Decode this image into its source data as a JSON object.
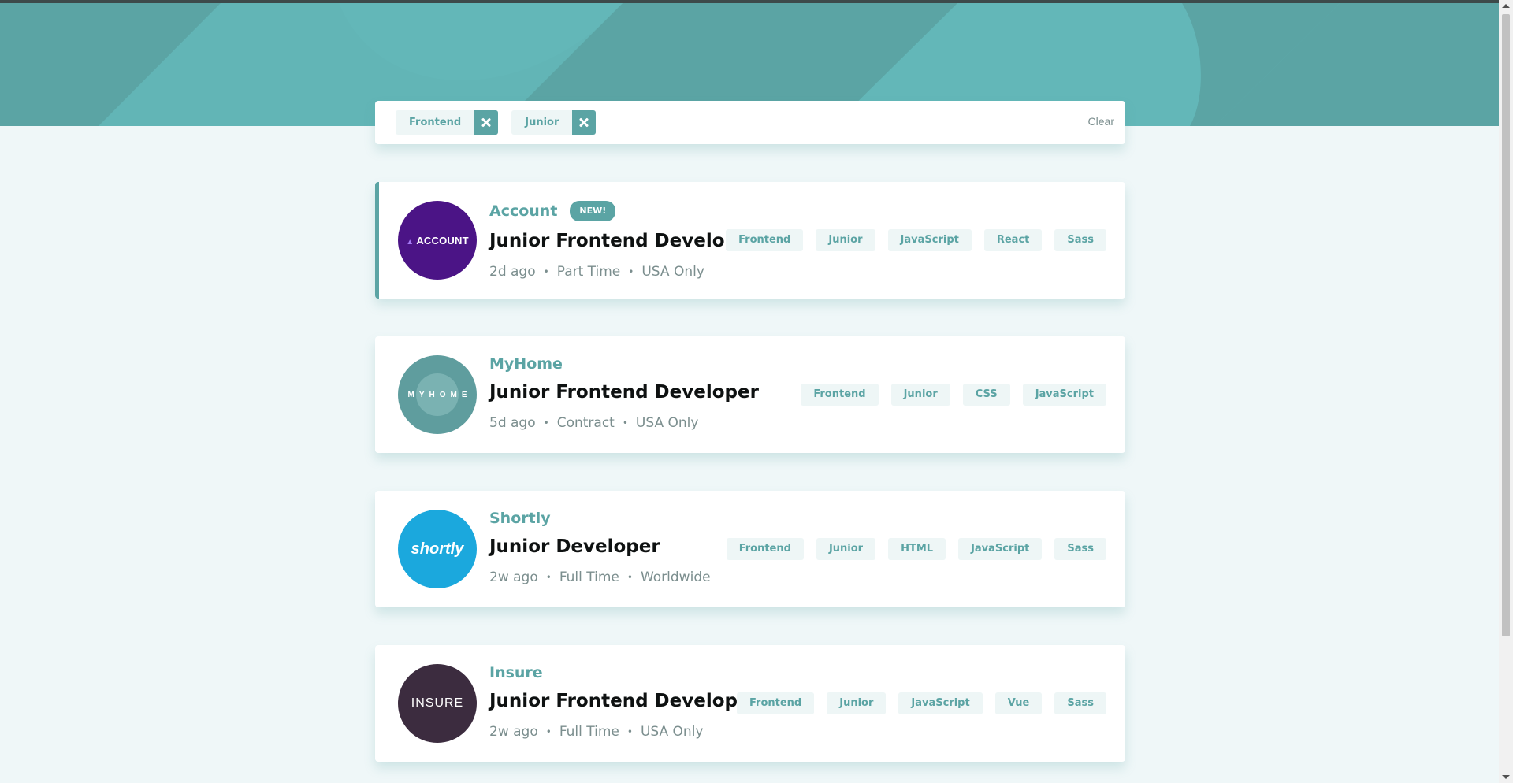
{
  "filters": {
    "active": [
      {
        "label": "Frontend"
      },
      {
        "label": "Junior"
      }
    ],
    "clear_label": "Clear"
  },
  "jobs": [
    {
      "company": "Account",
      "logo_text": "ACCOUNT",
      "logo_color": "#4b1486",
      "badge": "NEW!",
      "position": "Junior Frontend Developer",
      "posted": "2d ago",
      "contract": "Part Time",
      "location": "USA Only",
      "tags": [
        "Frontend",
        "Junior",
        "JavaScript",
        "React",
        "Sass"
      ]
    },
    {
      "company": "MyHome",
      "logo_text": "MYHOME",
      "logo_color": "#5f9d9e",
      "position": "Junior Frontend Developer",
      "posted": "5d ago",
      "contract": "Contract",
      "location": "USA Only",
      "tags": [
        "Frontend",
        "Junior",
        "CSS",
        "JavaScript"
      ]
    },
    {
      "company": "Shortly",
      "logo_text": "shortly",
      "logo_color": "#1ba8dd",
      "position": "Junior Developer",
      "posted": "2w ago",
      "contract": "Full Time",
      "location": "Worldwide",
      "tags": [
        "Frontend",
        "Junior",
        "HTML",
        "JavaScript",
        "Sass"
      ]
    },
    {
      "company": "Insure",
      "logo_text": "INSURE",
      "logo_color": "#3c2c3f",
      "position": "Junior Frontend Developer",
      "posted": "2w ago",
      "contract": "Full Time",
      "location": "USA Only",
      "tags": [
        "Frontend",
        "Junior",
        "JavaScript",
        "Vue",
        "Sass"
      ]
    }
  ],
  "colors": {
    "primary": "#5ba4a4",
    "background": "#eff7f8",
    "tag_bg": "#eef6f6",
    "muted_text": "#7b8e8e",
    "dark_text": "#0e1111"
  }
}
